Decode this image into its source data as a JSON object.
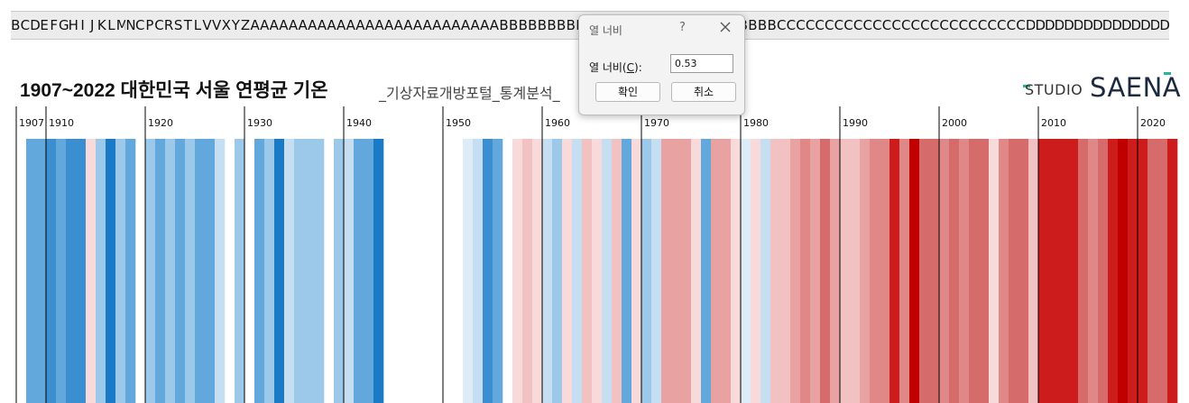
{
  "spreadsheet": {
    "column_headers": [
      "B",
      "C",
      "D",
      "E",
      "F",
      "G",
      "H",
      "I",
      "J",
      "K",
      "L",
      "M",
      "N",
      "C",
      "P",
      "C",
      "R",
      "S",
      "T",
      "L",
      "V",
      "V",
      "X",
      "Y",
      "Z",
      "A",
      "A",
      "A",
      "A",
      "A",
      "A",
      "A",
      "A",
      "A",
      "A",
      "A",
      "A",
      "A",
      "A",
      "A",
      "A",
      "A",
      "A",
      "A",
      "A",
      "A",
      "A",
      "A",
      "A",
      "A",
      "A",
      "B",
      "B",
      "B",
      "B",
      "B",
      "B",
      "B",
      "B",
      "B",
      "B",
      "B",
      "B",
      "B",
      "B",
      "B",
      "B",
      "B",
      "B",
      "B",
      "B",
      "B",
      "B",
      "B",
      "B",
      "B",
      "B",
      "B",
      "B",
      "B",
      "C",
      "C",
      "C",
      "C",
      "C",
      "C",
      "C",
      "C",
      "C",
      "C",
      "C",
      "C",
      "C",
      "C",
      "C",
      "C",
      "C",
      "C",
      "C",
      "C",
      "C",
      "C",
      "C",
      "C",
      "C",
      "C",
      "D",
      "D",
      "D",
      "D",
      "D",
      "D",
      "D",
      "D",
      "D",
      "D",
      "D",
      "D",
      "D",
      "D",
      "D"
    ]
  },
  "chart": {
    "title": "1907~2022 대한민국 서울 연평균 기온",
    "subtitle": "_기상자료개방포털_통계분석_",
    "logo": {
      "studio": "STUDIO",
      "saena": "SAENA",
      "accent": "#26b59a"
    }
  },
  "chart_data": {
    "type": "heatmap",
    "title": "1907~2022 대한민국 서울 연평균 기온",
    "x_ticks": [
      "1907",
      "1910",
      "1920",
      "1930",
      "1940",
      "1950",
      "1960",
      "1970",
      "1980",
      "1990",
      "2000",
      "2010",
      "2020"
    ],
    "years_start": 1907,
    "years_end": 2022,
    "colors": {
      "b5": "#1b7ac6",
      "b4": "#3b8fd1",
      "b3": "#62a8dc",
      "b2": "#9cc8ea",
      "b1": "#c6def2",
      "b0": "#deecf8",
      "r0": "#f8dada",
      "r1": "#f2c2c2",
      "r2": "#e9a2a2",
      "r3": "#e08888",
      "r4": "#d66b6b",
      "r5": "#cc1c1c",
      "r6": "#c00000",
      "none": "#ffffff"
    },
    "stripe_classes": [
      "none",
      "b3",
      "b3",
      "b4",
      "b3",
      "b4",
      "b4",
      "r0",
      "b2",
      "b5",
      "b2",
      "b3",
      "none",
      "b2",
      "b3",
      "b2",
      "b3",
      "b2",
      "b3",
      "b3",
      "b1",
      "none",
      "b2",
      "none",
      "b3",
      "b2",
      "b5",
      "b1",
      "b2",
      "b2",
      "b2",
      "none",
      "b2",
      "b1",
      "b3",
      "b3",
      "b5",
      "none",
      "none",
      "none",
      "none",
      "none",
      "none",
      "none",
      "none",
      "b0",
      "b1",
      "b4",
      "b3",
      "none",
      "r0",
      "r1",
      "r0",
      "b1",
      "b2",
      "r0",
      "b1",
      "r1",
      "r0",
      "b1",
      "r1",
      "b3",
      "r0",
      "b2",
      "b1",
      "r2",
      "r2",
      "r2",
      "r0",
      "b3",
      "r2",
      "r2",
      "r0",
      "b0",
      "r0",
      "b1",
      "r1",
      "r1",
      "r2",
      "r3",
      "r2",
      "r4",
      "r2",
      "r1",
      "r1",
      "r2",
      "r3",
      "r3",
      "r5",
      "r3",
      "r6",
      "r4",
      "r4",
      "r3",
      "r4",
      "r3",
      "r4",
      "r4",
      "r0",
      "r3",
      "r4",
      "r4",
      "r1",
      "r5",
      "r5",
      "r5",
      "r5",
      "r4",
      "r3",
      "r4",
      "r5",
      "r6",
      "r5",
      "r5",
      "r4",
      "r4",
      "r5"
    ]
  },
  "dialog": {
    "title": "열 너비",
    "help": "?",
    "field_label_prefix": "열 너비(",
    "field_label_key": "C",
    "field_label_suffix": "):",
    "width_value": "0.53",
    "ok_label": "확인",
    "cancel_label": "취소"
  }
}
